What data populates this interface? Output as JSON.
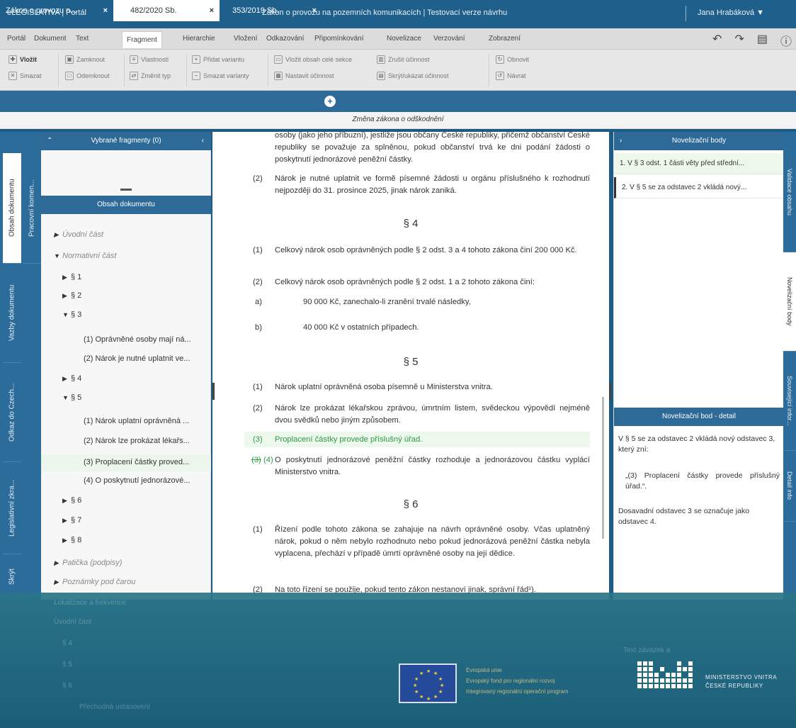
{
  "titlebar": {
    "app": "eLEGISLATIVA  |  Portál",
    "document_title": "Zákon o provozu na pozemních komunikacích | Testovací verze návrhu",
    "user": "Jana Hrabáková ▼"
  },
  "menu": {
    "items": [
      "Portál",
      "Dokument",
      "Text",
      "Fragment",
      "Hierarchie",
      "Vložení",
      "Odkazování",
      "Připomínkování",
      "Novelizace",
      "Verzování",
      "Zobrazení"
    ],
    "active_index": 3,
    "undo_icon": "undo-icon",
    "redo_icon": "redo-icon",
    "save_icon": "document-icon",
    "help_icon": "help-icon"
  },
  "toolbar": {
    "buttons": [
      {
        "name": "vlozit",
        "label": "Vložit",
        "icon": "insert-icon"
      },
      {
        "name": "smazat",
        "label": "Smazat",
        "icon": "delete-icon"
      },
      {
        "name": "zamknout",
        "label": "Zamknout",
        "icon": "lock-icon"
      },
      {
        "name": "odemknout",
        "label": "Odemknout",
        "icon": "unlock-icon"
      },
      {
        "name": "vlastnosti",
        "label": "Vlastnosti",
        "icon": "properties-icon"
      },
      {
        "name": "zmenit-typ",
        "label": "Změnit typ",
        "icon": "change-type-icon"
      },
      {
        "name": "pridat-variantu",
        "label": "Přidat variantu",
        "icon": "add-variant-icon"
      },
      {
        "name": "smazat-varianty",
        "label": "Smazat varianty",
        "icon": "delete-variant-icon"
      },
      {
        "name": "vlozit-obsah-sekce",
        "label": "Vložit obsah celé sekce",
        "icon": "insert-section-icon"
      },
      {
        "name": "nastavit-ucinnost",
        "label": "Nastavit účinnost",
        "icon": "calendar-icon"
      },
      {
        "name": "zrusit-ucinnost",
        "label": "Zrušit účinnost",
        "icon": "cancel-effect-icon"
      },
      {
        "name": "skryt-ucinnost",
        "label": "Skrýt/ukázat účinnost",
        "icon": "toggle-effect-icon"
      },
      {
        "name": "obnovit",
        "label": "Obnovit",
        "icon": "refresh-icon"
      },
      {
        "name": "navrat",
        "label": "Návrat",
        "icon": "return-icon"
      }
    ]
  },
  "tabs": [
    {
      "label": "Zákon o provozu n...",
      "close": "×"
    },
    {
      "label": "482/2020 Sb.",
      "close": "×"
    },
    {
      "label": "353/2019 Sb.",
      "close": "×"
    }
  ],
  "change_header": "Změna zákona o odškodnění",
  "left_vtabs": [
    "Obsah dokumentu",
    "Vazby dokumentu",
    "Odkaz do Czech...",
    "Legislativní zkra...",
    "Skrýt"
  ],
  "left_vtabs_inner": [
    "Pracovní komen..."
  ],
  "left_panel": {
    "selected_title": "Vybrané fragmenty (0)",
    "contents_title": "Obsah dokumentu",
    "tree": [
      {
        "label": "Úvodní část",
        "level": 0,
        "tri": "▶",
        "muted": true
      },
      {
        "label": "Normativní část",
        "level": 0,
        "tri": "▼",
        "muted": true
      },
      {
        "label": "§ 1",
        "level": 1,
        "tri": "▶"
      },
      {
        "label": "§ 2",
        "level": 1,
        "tri": "▶"
      },
      {
        "label": "§ 3",
        "level": 1,
        "tri": "▼"
      },
      {
        "label": "(1) Oprávněné osoby mají ná...",
        "level": 2
      },
      {
        "label": "(2) Nárok je nutné uplatnit ve...",
        "level": 2
      },
      {
        "label": "§ 4",
        "level": 1,
        "tri": "▶"
      },
      {
        "label": "§ 5",
        "level": 1,
        "tri": "▼"
      },
      {
        "label": "(1) Nárok uplatní oprávněná ...",
        "level": 2
      },
      {
        "label": "(2) Nárok lze prokázat lékařs...",
        "level": 2
      },
      {
        "label": "(3) Proplacení částky proved...",
        "level": 2,
        "selected": true
      },
      {
        "label": "(4) O poskytnutí jednorázové...",
        "level": 2
      },
      {
        "label": "§ 6",
        "level": 1,
        "tri": "▶"
      },
      {
        "label": "§ 7",
        "level": 1,
        "tri": "▶"
      },
      {
        "label": "§ 8",
        "level": 1,
        "tri": "▶"
      },
      {
        "label": "Patička (podpisy)",
        "level": 0,
        "tri": "▶",
        "muted": true
      },
      {
        "label": "Poznámky pod čarou",
        "level": 0,
        "tri": "▶",
        "muted": true
      }
    ]
  },
  "document": {
    "top_para": "osoby (jako jeho příbuzní), jestliže jsou občany České republiky, přičemž občanství České republiky se považuje za splněnou, pokud občanství trvá ke dni podání žádosti o poskytnutí jednorázové peněžní částky.",
    "s3_p2_num": "(2)",
    "s3_p2": "Nárok je nutné uplatnit ve formě písemné žádosti u orgánu příslušného k rozhodnutí nejpozději do 31. prosince 2025, jinak nárok zaniká.",
    "s4_title": "§ 4",
    "s4_p1_num": "(1)",
    "s4_p1": "Celkový nárok osob oprávněných podle § 2 odst. 3 a 4 tohoto zákona činí 200 000 Kč.",
    "s4_p2_num": "(2)",
    "s4_p2": "Celkový nárok osob oprávněných podle § 2 odst. 1 a 2 tohoto zákona činí:",
    "s4_a_num": "a)",
    "s4_a": "90 000 Kč, zanechalo-li zranění trvalé následky,",
    "s4_b_num": "b)",
    "s4_b": "40 000 Kč v ostatních případech.",
    "s5_title": "§ 5",
    "s5_p1_num": "(1)",
    "s5_p1": "Nárok uplatní oprávněná osoba písemně u Ministerstva vnitra.",
    "s5_p2_num": "(2)",
    "s5_p2": "Nárok lze prokázat lékařskou zprávou, úmrtním listem, svědeckou výpovědí nejméně dvou svědků nebo jiným způsobem.",
    "s5_p3_num": "(3)",
    "s5_p3": "Proplacení částky provede příslušný úřad.",
    "s5_p4_num_old": "(3)",
    "s5_p4_num_new": "(4)",
    "s5_p4": "O poskytnutí jednorázové peněžní částky rozhoduje a jednorázovou částku vyplácí Ministerstvo vnitra.",
    "s6_title": "§ 6",
    "s6_p1_num": "(1)",
    "s6_p1": "Řízení podle tohoto zákona se zahajuje na návrh oprávněné osoby. Včas uplatněný nárok, pokud o něm nebylo rozhodnuto nebo pokud jednorázová peněžní částka nebyla vyplacena, přechází v případě úmrtí oprávněné osoby na její dědice.",
    "s6_p2_num": "(2)",
    "s6_p2": "Na toto řízení se použije, pokud tento zákon nestanoví jinak, správní řád¹)."
  },
  "right_panel": {
    "title": "Novelizační body",
    "items": [
      {
        "label": "1. V § 3 odst. 1 části věty před střední...",
        "green": true
      },
      {
        "label": "2. V § 5 se za odstavec 2 vkládá nový...",
        "active": true
      }
    ],
    "detail_title": "Novelizační bod - detail",
    "detail_p1": "V § 5 se za odstavec 2 vkládá nový odstavec 3, který zní:",
    "detail_p2": "„(3) Proplacení částky provede příslušný úřad.“.",
    "detail_p3": "Dosavadní odstavec 3 se označuje jako odstavec 4."
  },
  "right_vtabs": [
    "Validace obsahu",
    "Novelizační body",
    "Související infor...",
    "Detail info"
  ],
  "footer": {
    "ghost_left": [
      "Lokalizace a frekvence",
      "Úvodní část",
      "§ 4",
      "§ 5",
      "§ 6",
      "Přechodná ustanovení"
    ],
    "eu_lines": [
      "Evropská unie",
      "Evropský fond pro regionální rozvoj",
      "Integrovaný regionální operační program"
    ],
    "mv_lines": [
      "MINISTERSTVO VNITRA",
      "ČESKÉ REPUBLIKY"
    ],
    "ghost_right": "Text závazek a"
  },
  "colors": {
    "brand": "#1f5f8b",
    "panel_header": "#2d6a97",
    "green_text": "#2e9a45",
    "selected_bg": "#edf8ec",
    "footer_overlay": "#2a7588"
  }
}
